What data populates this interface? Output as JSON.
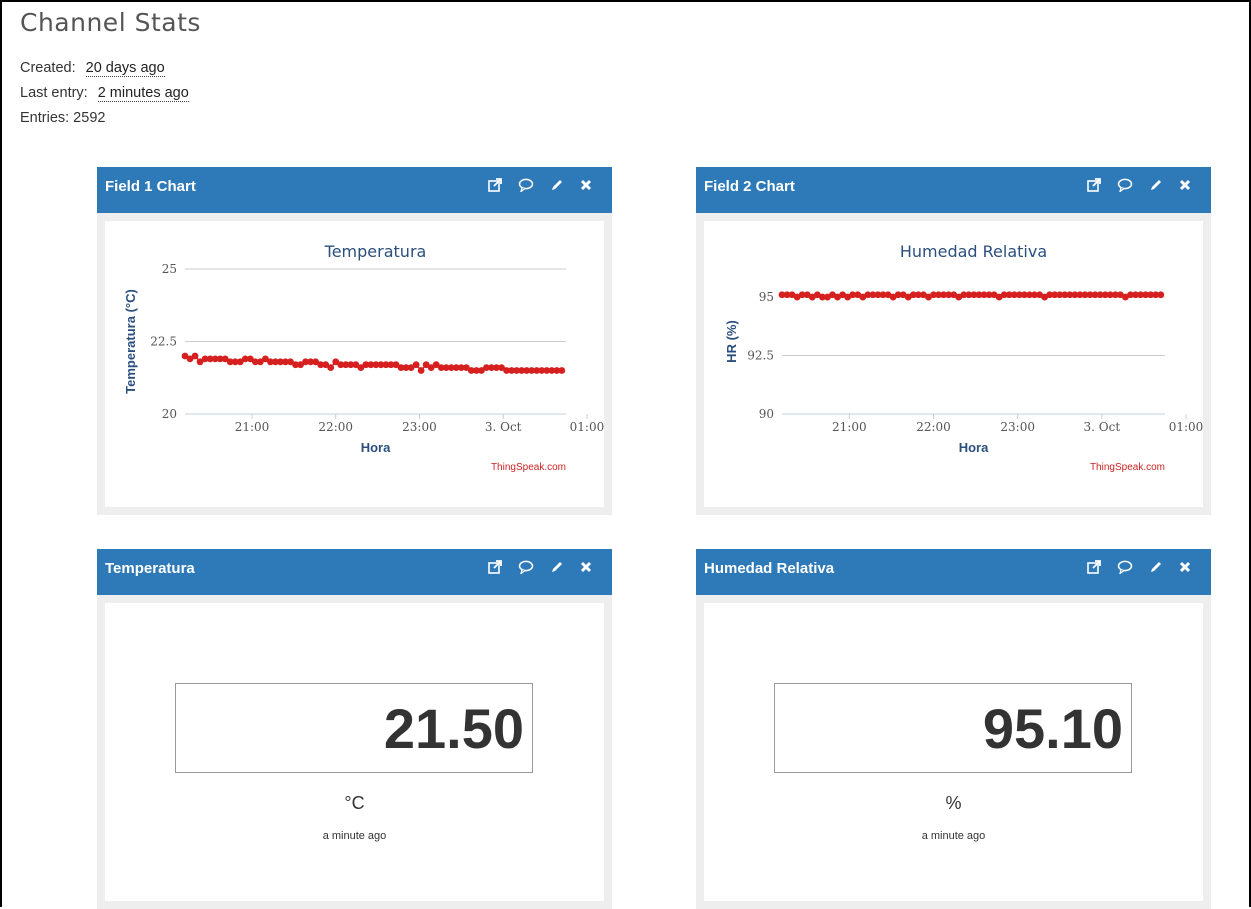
{
  "page": {
    "title": "Channel Stats"
  },
  "stats": {
    "created_label": "Created:",
    "created_value": "20 days ago",
    "last_entry_label": "Last entry:",
    "last_entry_value": "2 minutes ago",
    "entries": "Entries: 2592"
  },
  "widgets": [
    {
      "title": "Field 1 Chart"
    },
    {
      "title": "Field 2 Chart"
    },
    {
      "title": "Temperatura",
      "value": "21.50",
      "unit": "°C",
      "time": "a minute ago"
    },
    {
      "title": "Humedad Relativa",
      "value": "95.10",
      "unit": "%",
      "time": "a minute ago"
    }
  ],
  "icons": [
    "external-link-icon",
    "comment-icon",
    "pencil-icon",
    "close-icon"
  ],
  "colors": {
    "header": "#2e7ab8",
    "series": "#d62020",
    "axis_text": "#2b4f7e",
    "credit": "#cc2222"
  },
  "chart_data": [
    {
      "type": "line",
      "title": "Temperatura",
      "xlabel": "Hora",
      "ylabel": "Temperatura (°C)",
      "ylim": [
        20,
        25
      ],
      "yticks": [
        "20",
        "22.5",
        "25"
      ],
      "xticks": [
        "21:00",
        "22:00",
        "23:00",
        "3. Oct",
        "01:00"
      ],
      "xrange": [
        0.0,
        4.55
      ],
      "xtick_positions": [
        0.8,
        1.8,
        2.8,
        3.8,
        4.8
      ],
      "credit": "ThingSpeak.com",
      "series": [
        {
          "x": [
            0.0,
            0.06,
            0.12,
            0.18,
            0.24,
            0.3,
            0.36,
            0.42,
            0.48,
            0.54,
            0.6,
            0.66,
            0.72,
            0.78,
            0.84,
            0.9,
            0.96,
            1.02,
            1.08,
            1.14,
            1.2,
            1.26,
            1.32,
            1.38,
            1.44,
            1.5,
            1.56,
            1.62,
            1.68,
            1.74,
            1.8,
            1.86,
            1.92,
            1.98,
            2.04,
            2.1,
            2.16,
            2.22,
            2.28,
            2.34,
            2.4,
            2.46,
            2.52,
            2.58,
            2.64,
            2.7,
            2.76,
            2.82,
            2.88,
            2.94,
            3.0,
            3.06,
            3.12,
            3.18,
            3.24,
            3.3,
            3.36,
            3.42,
            3.48,
            3.54,
            3.6,
            3.66,
            3.72,
            3.78,
            3.84,
            3.9,
            3.96,
            4.02,
            4.08,
            4.14,
            4.2,
            4.26,
            4.32,
            4.38,
            4.44,
            4.5
          ],
          "y": [
            22.0,
            21.9,
            22.0,
            21.8,
            21.9,
            21.9,
            21.9,
            21.9,
            21.9,
            21.8,
            21.8,
            21.8,
            21.9,
            21.9,
            21.8,
            21.8,
            21.9,
            21.8,
            21.8,
            21.8,
            21.8,
            21.8,
            21.7,
            21.7,
            21.8,
            21.8,
            21.8,
            21.7,
            21.7,
            21.6,
            21.8,
            21.7,
            21.7,
            21.7,
            21.7,
            21.6,
            21.7,
            21.7,
            21.7,
            21.7,
            21.7,
            21.7,
            21.7,
            21.6,
            21.6,
            21.6,
            21.7,
            21.5,
            21.7,
            21.6,
            21.7,
            21.6,
            21.6,
            21.6,
            21.6,
            21.6,
            21.6,
            21.5,
            21.5,
            21.5,
            21.6,
            21.6,
            21.6,
            21.6,
            21.5,
            21.5,
            21.5,
            21.5,
            21.5,
            21.5,
            21.5,
            21.5,
            21.5,
            21.5,
            21.5,
            21.5
          ]
        }
      ]
    },
    {
      "type": "line",
      "title": "Humedad Relativa",
      "xlabel": "Hora",
      "ylabel": "HR (%)",
      "ylim": [
        90,
        96.2
      ],
      "yticks": [
        "90",
        "92.5",
        "95"
      ],
      "xticks": [
        "21:00",
        "22:00",
        "23:00",
        "3. Oct",
        "01:00"
      ],
      "xrange": [
        0.0,
        4.55
      ],
      "xtick_positions": [
        0.8,
        1.8,
        2.8,
        3.8,
        4.8
      ],
      "credit": "ThingSpeak.com",
      "series": [
        {
          "x": [
            0.0,
            0.06,
            0.12,
            0.18,
            0.24,
            0.3,
            0.36,
            0.42,
            0.48,
            0.54,
            0.6,
            0.66,
            0.72,
            0.78,
            0.84,
            0.9,
            0.96,
            1.02,
            1.08,
            1.14,
            1.2,
            1.26,
            1.32,
            1.38,
            1.44,
            1.5,
            1.56,
            1.62,
            1.68,
            1.74,
            1.8,
            1.86,
            1.92,
            1.98,
            2.04,
            2.1,
            2.16,
            2.22,
            2.28,
            2.34,
            2.4,
            2.46,
            2.52,
            2.58,
            2.64,
            2.7,
            2.76,
            2.82,
            2.88,
            2.94,
            3.0,
            3.06,
            3.12,
            3.18,
            3.24,
            3.3,
            3.36,
            3.42,
            3.48,
            3.54,
            3.6,
            3.66,
            3.72,
            3.78,
            3.84,
            3.9,
            3.96,
            4.02,
            4.08,
            4.14,
            4.2,
            4.26,
            4.32,
            4.38,
            4.44,
            4.5
          ],
          "y": [
            95.1,
            95.1,
            95.1,
            95.0,
            95.1,
            95.1,
            95.0,
            95.1,
            95.0,
            95.0,
            95.1,
            95.0,
            95.1,
            95.0,
            95.1,
            95.1,
            95.0,
            95.1,
            95.1,
            95.1,
            95.1,
            95.1,
            95.0,
            95.1,
            95.1,
            95.0,
            95.1,
            95.1,
            95.1,
            95.0,
            95.1,
            95.1,
            95.1,
            95.1,
            95.1,
            95.0,
            95.1,
            95.1,
            95.1,
            95.1,
            95.1,
            95.1,
            95.1,
            95.0,
            95.1,
            95.1,
            95.1,
            95.1,
            95.1,
            95.1,
            95.1,
            95.1,
            95.0,
            95.1,
            95.1,
            95.1,
            95.1,
            95.1,
            95.1,
            95.1,
            95.1,
            95.1,
            95.1,
            95.1,
            95.1,
            95.1,
            95.1,
            95.1,
            95.0,
            95.1,
            95.1,
            95.1,
            95.1,
            95.1,
            95.1,
            95.1
          ]
        }
      ]
    }
  ]
}
